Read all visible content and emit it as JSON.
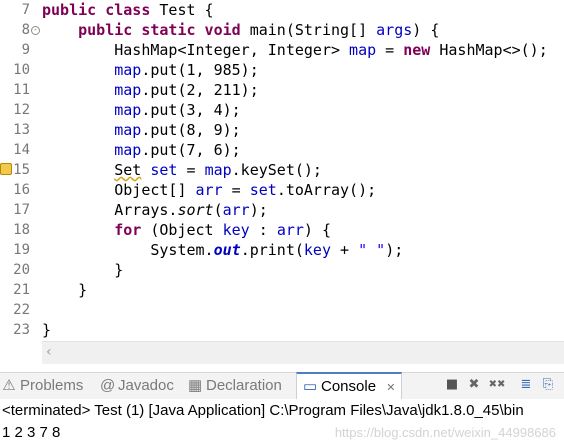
{
  "editor": {
    "lines": [
      {
        "n": "7",
        "tokens": [
          {
            "t": "public class ",
            "c": "kw"
          },
          {
            "t": "Test {",
            "c": ""
          }
        ]
      },
      {
        "n": "8",
        "fold": "⊖",
        "tokens": [
          {
            "t": "    ",
            "c": ""
          },
          {
            "t": "public static void ",
            "c": "kw"
          },
          {
            "t": "main(String[] ",
            "c": ""
          },
          {
            "t": "args",
            "c": "fld"
          },
          {
            "t": ") {",
            "c": ""
          }
        ]
      },
      {
        "n": "9",
        "tokens": [
          {
            "t": "        HashMap<Integer, Integer> ",
            "c": ""
          },
          {
            "t": "map",
            "c": "fld"
          },
          {
            "t": " = ",
            "c": ""
          },
          {
            "t": "new ",
            "c": "kw"
          },
          {
            "t": "HashMap<>();",
            "c": ""
          }
        ]
      },
      {
        "n": "10",
        "tokens": [
          {
            "t": "        ",
            "c": ""
          },
          {
            "t": "map",
            "c": "fld"
          },
          {
            "t": ".put(1, 985);",
            "c": ""
          }
        ]
      },
      {
        "n": "11",
        "tokens": [
          {
            "t": "        ",
            "c": ""
          },
          {
            "t": "map",
            "c": "fld"
          },
          {
            "t": ".put(2, 211);",
            "c": ""
          }
        ]
      },
      {
        "n": "12",
        "tokens": [
          {
            "t": "        ",
            "c": ""
          },
          {
            "t": "map",
            "c": "fld"
          },
          {
            "t": ".put(3, 4);",
            "c": ""
          }
        ]
      },
      {
        "n": "13",
        "tokens": [
          {
            "t": "        ",
            "c": ""
          },
          {
            "t": "map",
            "c": "fld"
          },
          {
            "t": ".put(8, 9);",
            "c": ""
          }
        ]
      },
      {
        "n": "14",
        "tokens": [
          {
            "t": "        ",
            "c": ""
          },
          {
            "t": "map",
            "c": "fld"
          },
          {
            "t": ".put(7, 6);",
            "c": ""
          }
        ]
      },
      {
        "n": "15",
        "warn": true,
        "tokens": [
          {
            "t": "        ",
            "c": ""
          },
          {
            "t": "Set",
            "c": "warn-under"
          },
          {
            "t": " ",
            "c": ""
          },
          {
            "t": "set",
            "c": "fld"
          },
          {
            "t": " = ",
            "c": ""
          },
          {
            "t": "map",
            "c": "fld"
          },
          {
            "t": ".keySet();",
            "c": ""
          }
        ]
      },
      {
        "n": "16",
        "tokens": [
          {
            "t": "        Object[] ",
            "c": ""
          },
          {
            "t": "arr",
            "c": "fld"
          },
          {
            "t": " = ",
            "c": ""
          },
          {
            "t": "set",
            "c": "fld"
          },
          {
            "t": ".toArray();",
            "c": ""
          }
        ]
      },
      {
        "n": "17",
        "tokens": [
          {
            "t": "        Arrays.",
            "c": ""
          },
          {
            "t": "sort",
            "c": "it"
          },
          {
            "t": "(",
            "c": ""
          },
          {
            "t": "arr",
            "c": "fld"
          },
          {
            "t": ");",
            "c": ""
          }
        ]
      },
      {
        "n": "18",
        "tokens": [
          {
            "t": "        ",
            "c": ""
          },
          {
            "t": "for ",
            "c": "kw"
          },
          {
            "t": "(Object ",
            "c": ""
          },
          {
            "t": "key",
            "c": "fld"
          },
          {
            "t": " : ",
            "c": ""
          },
          {
            "t": "arr",
            "c": "fld"
          },
          {
            "t": ") {",
            "c": ""
          }
        ]
      },
      {
        "n": "19",
        "tokens": [
          {
            "t": "            System.",
            "c": ""
          },
          {
            "t": "out",
            "c": "fldi"
          },
          {
            "t": ".print(",
            "c": ""
          },
          {
            "t": "key",
            "c": "fld"
          },
          {
            "t": " + ",
            "c": ""
          },
          {
            "t": "\" \"",
            "c": "str"
          },
          {
            "t": ");",
            "c": ""
          }
        ]
      },
      {
        "n": "20",
        "tokens": [
          {
            "t": "        }",
            "c": ""
          }
        ]
      },
      {
        "n": "21",
        "tokens": [
          {
            "t": "    }",
            "c": ""
          }
        ]
      },
      {
        "n": "22",
        "tokens": []
      },
      {
        "n": "23",
        "tokens": [
          {
            "t": "}",
            "c": ""
          }
        ]
      }
    ]
  },
  "scrollbar": {
    "left_arrow": "‹"
  },
  "tabs": [
    {
      "label": "Problems",
      "icon": "⚠",
      "icon_name": "problems-icon"
    },
    {
      "label": "Javadoc",
      "icon": "@",
      "icon_name": "at-icon"
    },
    {
      "label": "Declaration",
      "icon": "▦",
      "icon_name": "declaration-icon"
    },
    {
      "label": "Console",
      "icon": "▭",
      "icon_name": "console-icon",
      "active": true,
      "close": "✕"
    }
  ],
  "toolbar": [
    {
      "glyph": "■",
      "name": "terminate-icon"
    },
    {
      "glyph": "✖",
      "name": "remove-launch-icon"
    },
    {
      "glyph": "✖✖",
      "name": "remove-all-icon"
    },
    {
      "glyph": "≣",
      "name": "scroll-lock-icon"
    },
    {
      "glyph": "⎘",
      "name": "pin-console-icon"
    }
  ],
  "console": {
    "header": "<terminated> Test (1) [Java Application] C:\\Program Files\\Java\\jdk1.8.0_45\\bin",
    "output": "1 2 3 7 8"
  },
  "watermark": "https://blog.csdn.net/weixin_44998686"
}
